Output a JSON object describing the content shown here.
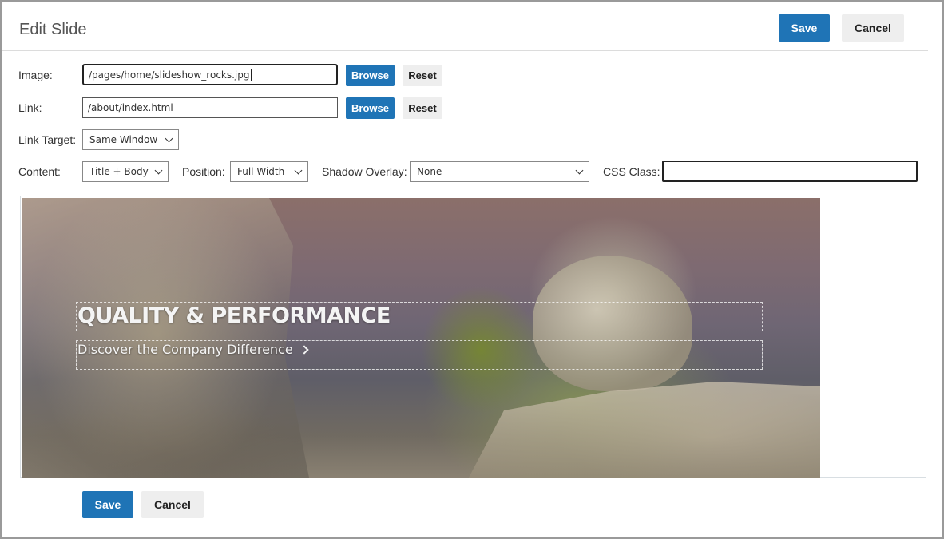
{
  "header": {
    "title": "Edit Slide",
    "save_label": "Save",
    "cancel_label": "Cancel"
  },
  "form": {
    "image": {
      "label": "Image:",
      "value": "/pages/home/slideshow_rocks.jpg",
      "browse_label": "Browse",
      "reset_label": "Reset"
    },
    "link": {
      "label": "Link:",
      "value": "/about/index.html",
      "browse_label": "Browse",
      "reset_label": "Reset"
    },
    "link_target": {
      "label": "Link Target:",
      "selected": "Same Window"
    },
    "content": {
      "label": "Content:",
      "selected": "Title + Body"
    },
    "position": {
      "label": "Position:",
      "selected": "Full Width"
    },
    "shadow_overlay": {
      "label": "Shadow Overlay:",
      "selected": "None"
    },
    "css_class": {
      "label": "CSS Class:",
      "value": ""
    }
  },
  "preview": {
    "title": "QUALITY & PERFORMANCE",
    "body": "Discover the Company Difference"
  },
  "footer": {
    "save_label": "Save",
    "cancel_label": "Cancel"
  },
  "colors": {
    "primary": "#1f74b6",
    "secondary": "#eeeeee"
  }
}
